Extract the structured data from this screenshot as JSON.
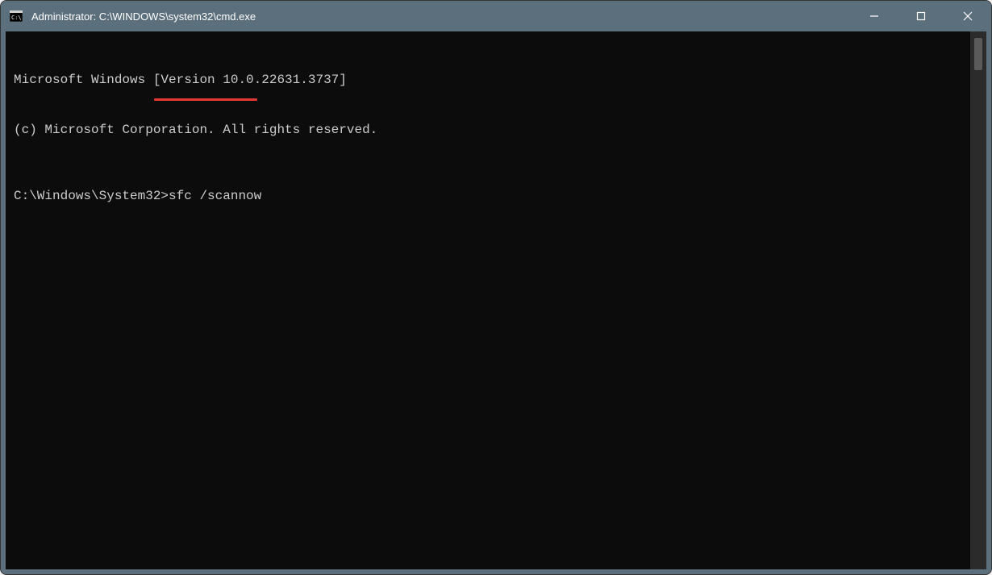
{
  "window": {
    "title": "Administrator: C:\\WINDOWS\\system32\\cmd.exe"
  },
  "terminal": {
    "line1": "Microsoft Windows [Version 10.0.22631.3737]",
    "line2": "(c) Microsoft Corporation. All rights reserved.",
    "prompt": "C:\\Windows\\System32>",
    "command": "sfc /scannow"
  },
  "annotation": {
    "underline_color": "#e53935"
  }
}
